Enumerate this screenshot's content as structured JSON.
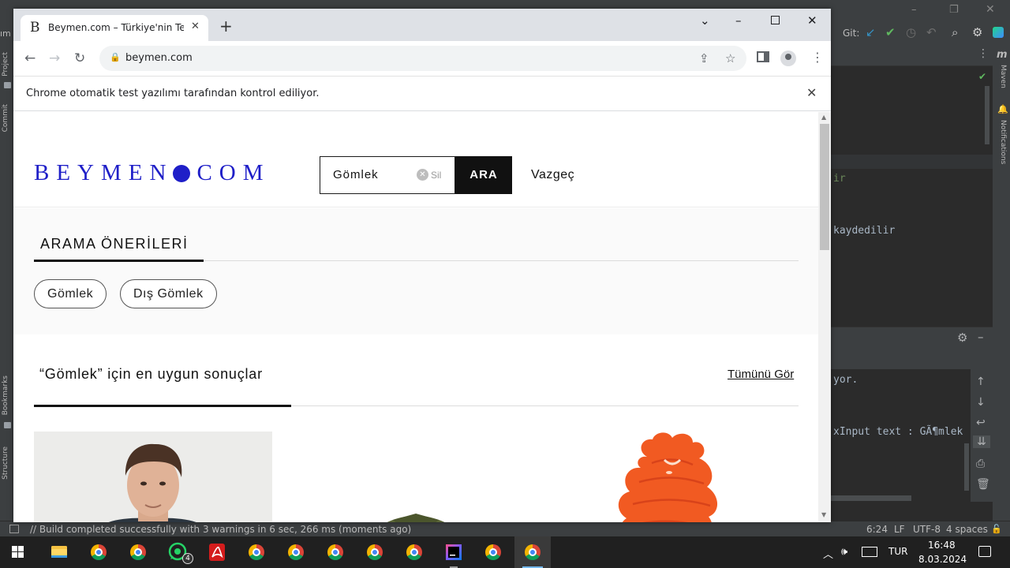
{
  "ide": {
    "toolbar": {
      "git_label": "Git:"
    },
    "left_tabs": [
      "Project",
      "Commit",
      "Bookmarks",
      "Structure"
    ],
    "right_tabs": [
      "Maven",
      "Notifications"
    ],
    "maven_icon": "m",
    "editor_lines": [
      "ir",
      "kaydedilir"
    ],
    "console_lines": [
      "yor.",
      "xInput text : GÃ¶mlek"
    ],
    "status": {
      "message": "// Build completed successfully with 3 warnings in 6 sec, 266 ms (moments ago)",
      "position": "6:24",
      "line_ending": "LF",
      "encoding": "UTF-8",
      "indent": "4 spaces"
    }
  },
  "browser": {
    "tab": {
      "title": "Beymen.com – Türkiye'nin Tek D",
      "favicon": "B"
    },
    "url": "beymen.com",
    "infobar": "Chrome otomatik test yazılımı tarafından kontrol ediliyor."
  },
  "page": {
    "logo_left": "BEYMEN",
    "logo_right": "COM",
    "search": {
      "value": "Gömlek",
      "clear_label": "Sil",
      "button_label": "ARA",
      "cancel_label": "Vazgeç"
    },
    "suggestions": {
      "title": "ARAMA ÖNERİLERİ",
      "items": [
        "Gömlek",
        "Dış Gömlek"
      ]
    },
    "results": {
      "title": "“Gömlek” için en uygun sonuçlar",
      "see_all": "Tümünü Gör"
    }
  },
  "taskbar": {
    "apps": [
      "start",
      "file-explorer",
      "chrome",
      "chrome",
      "whatsapp",
      "acrobat",
      "chrome",
      "chrome",
      "chrome",
      "chrome",
      "chrome",
      "intellij",
      "chrome",
      "chrome"
    ],
    "whatsapp_badge": "4",
    "language": "TUR",
    "time": "16:48",
    "date": "8.03.2024"
  },
  "colors": {
    "brand": "#1f1fc8",
    "search_button": "#111111"
  }
}
